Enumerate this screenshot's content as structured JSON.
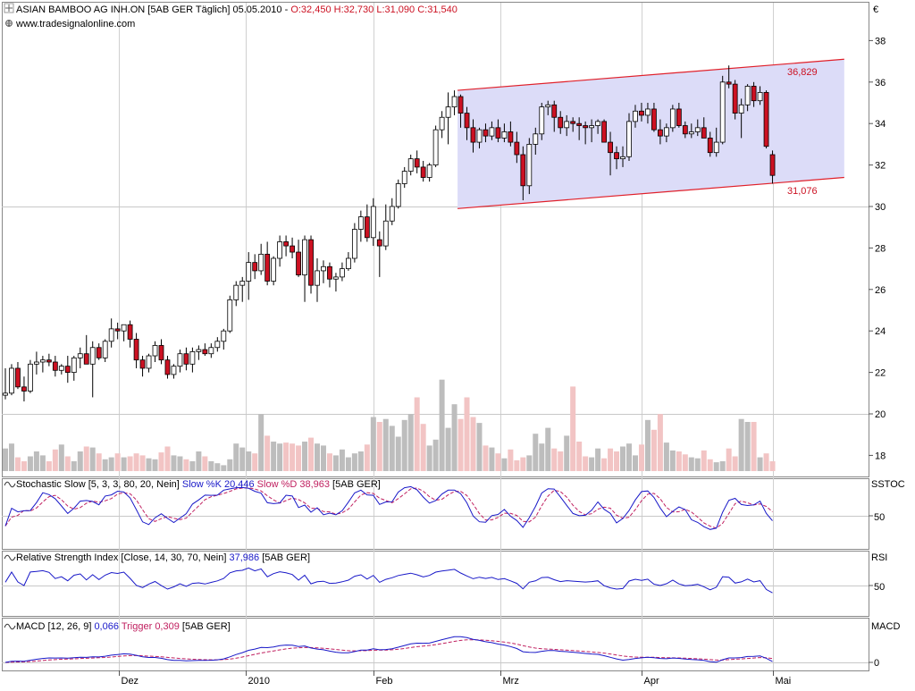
{
  "header": {
    "title_black": "ASIAN BAMBOO AG  INH.ON [5AB GER  Täglich] 05.05.2010 - ",
    "title_red": "O:32,450 H:32,730 L:31,090 C:31,540",
    "url": "www.tradesignalonline.com",
    "currency": "€"
  },
  "panes": {
    "stoch": {
      "label_pre": "Stochastic Slow [5, 3, 3, 80, 20, Nein] ",
      "label_k": "Slow %K 20,446",
      "label_d": " Slow %D 38,963",
      "label_post": " [5AB GER]",
      "right": "SSTOC",
      "tick": "50"
    },
    "rsi": {
      "label_pre": "Relative Strength Index [Close, 14, 30, 70, Nein] ",
      "label_val": "37,986",
      "label_post": " [5AB GER]",
      "right": "RSI",
      "tick": "50"
    },
    "macd": {
      "label_pre": "MACD [12, 26, 9] ",
      "label_val": "0,066",
      "label_trig": " Trigger 0,309",
      "label_post": " [5AB GER]",
      "right": "MACD",
      "tick": "0"
    }
  },
  "colors": {
    "up": "#ffffff",
    "down": "#cc1122",
    "channel_line": "#e0202a",
    "channel_fill": "#dcdcf8",
    "k_line": "#1818c8",
    "d_line": "#c02060",
    "vol_gray": "#bdbdbd",
    "vol_pink": "#f2c4c4"
  },
  "chart_data": {
    "type": "candlestick",
    "y_axis": {
      "min": 17,
      "max": 40,
      "ticks": [
        18,
        20,
        22,
        24,
        26,
        28,
        30,
        32,
        34,
        36,
        38
      ]
    },
    "x_labels": [
      "Dez",
      "2010",
      "Feb",
      "Mrz",
      "Apr",
      "Mai"
    ],
    "annotations": [
      {
        "text": "36,829",
        "kind": "high"
      },
      {
        "text": "31,076",
        "kind": "low"
      }
    ],
    "channel": {
      "upper": [
        35.6,
        37.1
      ],
      "lower": [
        29.9,
        31.4
      ]
    },
    "ohlc": [
      [
        20.9,
        22.2,
        20.7,
        21.0
      ],
      [
        21.0,
        22.4,
        20.9,
        22.2
      ],
      [
        22.2,
        22.5,
        21.2,
        21.3
      ],
      [
        21.3,
        21.8,
        20.6,
        21.1
      ],
      [
        21.1,
        22.6,
        21.0,
        22.4
      ],
      [
        22.4,
        23.0,
        21.9,
        22.5
      ],
      [
        22.5,
        22.8,
        22.0,
        22.6
      ],
      [
        22.6,
        22.9,
        22.3,
        22.5
      ],
      [
        22.5,
        22.8,
        21.8,
        22.1
      ],
      [
        22.1,
        22.4,
        21.9,
        22.3
      ],
      [
        22.3,
        22.8,
        21.5,
        22.0
      ],
      [
        22.0,
        22.8,
        21.6,
        22.7
      ],
      [
        22.7,
        23.2,
        22.2,
        22.9
      ],
      [
        22.9,
        23.8,
        22.5,
        22.4
      ],
      [
        22.4,
        23.5,
        20.8,
        23.2
      ],
      [
        23.2,
        23.4,
        22.6,
        22.7
      ],
      [
        22.7,
        23.6,
        22.5,
        23.5
      ],
      [
        23.5,
        24.6,
        23.2,
        24.1
      ],
      [
        24.1,
        24.4,
        23.6,
        24.0
      ],
      [
        24.0,
        24.3,
        23.5,
        24.3
      ],
      [
        24.3,
        24.5,
        23.2,
        23.6
      ],
      [
        23.6,
        23.9,
        22.2,
        22.6
      ],
      [
        22.6,
        22.8,
        21.8,
        22.2
      ],
      [
        22.2,
        22.9,
        22.0,
        22.8
      ],
      [
        22.8,
        23.5,
        22.5,
        23.3
      ],
      [
        23.3,
        23.6,
        22.4,
        22.6
      ],
      [
        22.6,
        22.8,
        21.7,
        21.9
      ],
      [
        21.9,
        22.4,
        21.7,
        22.3
      ],
      [
        22.3,
        23.1,
        22.0,
        22.9
      ],
      [
        22.9,
        23.2,
        22.1,
        22.4
      ],
      [
        22.4,
        23.2,
        22.0,
        23.0
      ],
      [
        23.0,
        23.3,
        22.6,
        23.1
      ],
      [
        23.1,
        23.4,
        22.8,
        22.9
      ],
      [
        22.9,
        23.4,
        22.7,
        23.2
      ],
      [
        23.2,
        23.7,
        23.0,
        23.5
      ],
      [
        23.5,
        24.1,
        23.1,
        24.0
      ],
      [
        24.0,
        25.7,
        23.9,
        25.5
      ],
      [
        25.5,
        26.4,
        25.2,
        26.2
      ],
      [
        26.2,
        26.6,
        25.4,
        26.4
      ],
      [
        26.4,
        27.8,
        25.5,
        27.3
      ],
      [
        27.3,
        27.7,
        26.5,
        26.9
      ],
      [
        26.9,
        28.2,
        26.7,
        27.7
      ],
      [
        27.7,
        28.3,
        26.2,
        26.4
      ],
      [
        26.4,
        27.6,
        26.2,
        27.5
      ],
      [
        27.5,
        28.6,
        27.1,
        28.3
      ],
      [
        28.3,
        28.6,
        27.6,
        28.1
      ],
      [
        28.1,
        28.5,
        27.5,
        27.8
      ],
      [
        27.8,
        28.4,
        26.6,
        26.7
      ],
      [
        26.7,
        28.6,
        25.4,
        28.4
      ],
      [
        28.4,
        28.6,
        25.8,
        26.2
      ],
      [
        26.2,
        27.5,
        25.4,
        26.9
      ],
      [
        26.9,
        27.4,
        26.3,
        27.1
      ],
      [
        27.1,
        27.3,
        26.1,
        26.5
      ],
      [
        26.5,
        26.8,
        25.9,
        26.6
      ],
      [
        26.6,
        27.3,
        26.4,
        27.0
      ],
      [
        27.0,
        27.8,
        26.9,
        27.5
      ],
      [
        27.5,
        29.2,
        27.3,
        28.9
      ],
      [
        28.9,
        29.8,
        28.3,
        29.5
      ],
      [
        29.5,
        30.1,
        28.3,
        28.5
      ],
      [
        28.5,
        30.4,
        28.1,
        30.0
      ],
      [
        28.4,
        28.8,
        26.6,
        28.1
      ],
      [
        28.1,
        30.1,
        27.9,
        29.3
      ],
      [
        29.3,
        30.4,
        29.1,
        30.0
      ],
      [
        30.0,
        31.3,
        29.9,
        31.1
      ],
      [
        31.1,
        31.9,
        30.9,
        31.7
      ],
      [
        31.7,
        32.5,
        31.5,
        32.3
      ],
      [
        32.3,
        32.7,
        31.6,
        31.9
      ],
      [
        31.9,
        32.2,
        31.2,
        31.4
      ],
      [
        31.4,
        32.1,
        31.2,
        32.0
      ],
      [
        32.0,
        33.9,
        31.9,
        33.7
      ],
      [
        33.7,
        34.6,
        33.3,
        34.3
      ],
      [
        34.3,
        35.5,
        33.0,
        34.8
      ],
      [
        34.8,
        35.6,
        34.4,
        35.3
      ],
      [
        35.3,
        35.4,
        33.8,
        34.5
      ],
      [
        34.5,
        34.8,
        33.2,
        33.8
      ],
      [
        33.8,
        34.2,
        32.6,
        33.1
      ],
      [
        33.1,
        33.8,
        32.8,
        33.7
      ],
      [
        33.7,
        34.0,
        33.1,
        33.4
      ],
      [
        33.4,
        34.1,
        33.2,
        33.8
      ],
      [
        33.8,
        34.2,
        33.1,
        33.3
      ],
      [
        33.3,
        34.0,
        33.1,
        33.6
      ],
      [
        33.6,
        34.1,
        32.9,
        33.1
      ],
      [
        33.1,
        33.6,
        32.1,
        32.5
      ],
      [
        32.5,
        32.9,
        30.3,
        31.0
      ],
      [
        31.0,
        33.3,
        30.6,
        33.0
      ],
      [
        33.0,
        33.8,
        32.5,
        33.5
      ],
      [
        33.5,
        35.0,
        33.2,
        34.8
      ],
      [
        34.8,
        35.1,
        34.4,
        34.9
      ],
      [
        34.9,
        35.1,
        33.6,
        34.3
      ],
      [
        34.3,
        34.6,
        33.5,
        33.8
      ],
      [
        33.8,
        34.4,
        33.4,
        34.1
      ],
      [
        34.1,
        34.3,
        33.6,
        34.0
      ],
      [
        34.0,
        34.3,
        33.2,
        33.9
      ],
      [
        33.9,
        34.1,
        33.0,
        33.8
      ],
      [
        33.8,
        34.2,
        33.1,
        33.9
      ],
      [
        33.9,
        34.2,
        33.5,
        34.1
      ],
      [
        34.1,
        34.2,
        33.1,
        33.1
      ],
      [
        33.1,
        33.6,
        31.5,
        32.6
      ],
      [
        32.6,
        32.9,
        31.8,
        32.3
      ],
      [
        32.3,
        32.9,
        31.9,
        32.4
      ],
      [
        32.4,
        34.5,
        32.2,
        34.1
      ],
      [
        34.1,
        34.9,
        33.8,
        34.6
      ],
      [
        34.6,
        35.0,
        34.1,
        34.4
      ],
      [
        34.4,
        35.0,
        34.0,
        34.7
      ],
      [
        34.7,
        35.0,
        33.6,
        33.7
      ],
      [
        33.7,
        34.2,
        33.0,
        33.4
      ],
      [
        33.4,
        34.0,
        33.1,
        33.8
      ],
      [
        33.8,
        34.9,
        33.6,
        34.7
      ],
      [
        34.7,
        35.0,
        33.8,
        33.9
      ],
      [
        33.9,
        34.1,
        33.3,
        33.5
      ],
      [
        33.5,
        34.0,
        33.3,
        33.6
      ],
      [
        33.6,
        34.2,
        33.4,
        33.8
      ],
      [
        33.8,
        34.3,
        33.3,
        33.3
      ],
      [
        33.3,
        33.6,
        32.4,
        32.6
      ],
      [
        32.6,
        33.8,
        32.4,
        33.1
      ],
      [
        33.1,
        36.3,
        33.0,
        36.0
      ],
      [
        36.0,
        36.8,
        35.7,
        35.9
      ],
      [
        35.9,
        36.1,
        34.2,
        34.5
      ],
      [
        34.5,
        35.2,
        33.3,
        34.9
      ],
      [
        34.9,
        35.9,
        34.6,
        35.8
      ],
      [
        35.8,
        36.0,
        34.8,
        35.1
      ],
      [
        35.1,
        35.8,
        34.9,
        35.5
      ],
      [
        35.5,
        35.6,
        32.8,
        32.9
      ],
      [
        32.5,
        32.7,
        31.1,
        31.5
      ]
    ],
    "volume_rel": [
      0.23,
      0.28,
      0.14,
      0.1,
      0.15,
      0.2,
      0.16,
      0.1,
      0.22,
      0.27,
      0.15,
      0.1,
      0.2,
      0.25,
      0.24,
      0.18,
      0.12,
      0.14,
      0.18,
      0.14,
      0.15,
      0.18,
      0.16,
      0.13,
      0.12,
      0.19,
      0.25,
      0.16,
      0.15,
      0.12,
      0.1,
      0.2,
      0.15,
      0.1,
      0.08,
      0.06,
      0.12,
      0.28,
      0.24,
      0.2,
      0.18,
      0.58,
      0.36,
      0.3,
      0.28,
      0.29,
      0.28,
      0.26,
      0.3,
      0.34,
      0.28,
      0.26,
      0.18,
      0.16,
      0.22,
      0.14,
      0.18,
      0.2,
      0.27,
      0.55,
      0.5,
      0.53,
      0.46,
      0.35,
      0.52,
      0.58,
      0.75,
      0.48,
      0.26,
      0.32,
      0.93,
      0.44,
      0.68,
      0.53,
      0.75,
      0.55,
      0.49,
      0.26,
      0.24,
      0.18,
      0.13,
      0.22,
      0.11,
      0.14,
      0.16,
      0.38,
      0.28,
      0.44,
      0.23,
      0.2,
      0.36,
      0.86,
      0.3,
      0.15,
      0.14,
      0.23,
      0.13,
      0.23,
      0.2,
      0.25,
      0.28,
      0.16,
      0.27,
      0.52,
      0.42,
      0.58,
      0.29,
      0.21,
      0.2,
      0.17,
      0.14,
      0.13,
      0.21,
      0.12,
      0.09,
      0.1,
      0.23,
      0.15,
      0.53,
      0.5,
      0.5,
      0.14,
      0.18,
      0.1,
      0.51,
      0.51
    ]
  }
}
